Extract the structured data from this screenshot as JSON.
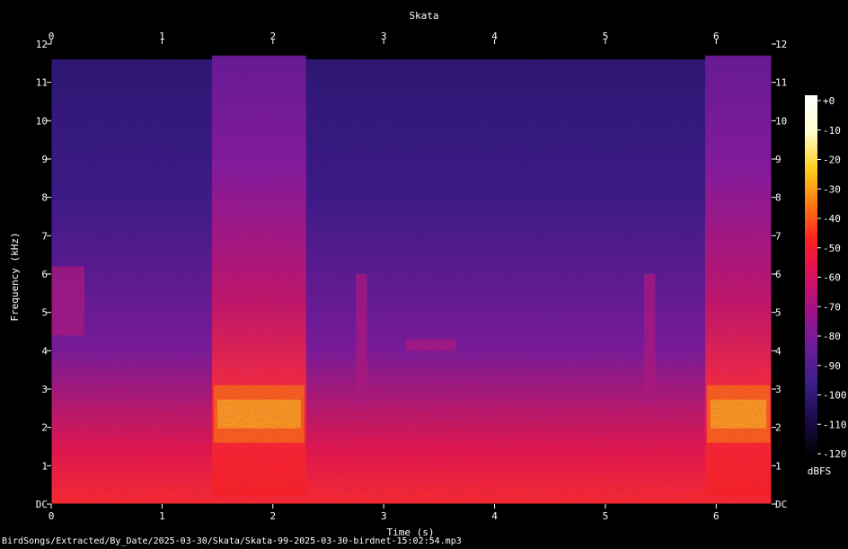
{
  "chart_data": {
    "type": "heatmap",
    "title": "Skata",
    "xlabel": "Time (s)",
    "ylabel": "Frequency (kHz)",
    "xlim": [
      0,
      6.5
    ],
    "ylim": [
      0,
      12
    ],
    "x_ticks": [
      "0",
      "1",
      "2",
      "3",
      "4",
      "5",
      "6"
    ],
    "y_ticks": [
      "DC",
      "1",
      "2",
      "3",
      "4",
      "5",
      "6",
      "7",
      "8",
      "9",
      "10",
      "11",
      "12"
    ],
    "colorbar": {
      "label": "dBFS",
      "ticks": [
        "+0",
        "-10",
        "-20",
        "-30",
        "-40",
        "-50",
        "-60",
        "-70",
        "-80",
        "-90",
        "-100",
        "-110",
        "-120"
      ],
      "range": [
        -120,
        0
      ],
      "colors": [
        "#000000",
        "#1a0a4a",
        "#3a1d8a",
        "#6a1d9e",
        "#a0108a",
        "#d81060",
        "#ff2020",
        "#ff7a10",
        "#ffd020",
        "#ffffd0",
        "#ffffff"
      ]
    },
    "events": [
      {
        "t_start": 1.45,
        "t_end": 2.3,
        "f_low": 0.2,
        "f_high": 11.7,
        "peak_f_low": 1.6,
        "peak_f_high": 3.1,
        "level_dbfs": -25
      },
      {
        "t_start": 5.9,
        "t_end": 6.5,
        "f_low": 0.2,
        "f_high": 11.7,
        "peak_f_low": 1.6,
        "peak_f_high": 3.1,
        "level_dbfs": -25
      },
      {
        "t_start": 0.0,
        "t_end": 0.3,
        "f_low": 4.4,
        "f_high": 6.2,
        "level_dbfs": -65
      },
      {
        "t_start": 2.75,
        "t_end": 2.85,
        "f_low": 2.6,
        "f_high": 6.0,
        "level_dbfs": -55
      },
      {
        "t_start": 3.2,
        "t_end": 3.65,
        "f_low": 4.0,
        "f_high": 4.3,
        "level_dbfs": -60
      },
      {
        "t_start": 5.35,
        "t_end": 5.45,
        "f_low": 2.6,
        "f_high": 6.0,
        "level_dbfs": -55
      }
    ]
  },
  "footer": {
    "file_path": "BirdSongs/Extracted/By_Date/2025-03-30/Skata/Skata-99-2025-03-30-birdnet-15:02:54.mp3"
  }
}
